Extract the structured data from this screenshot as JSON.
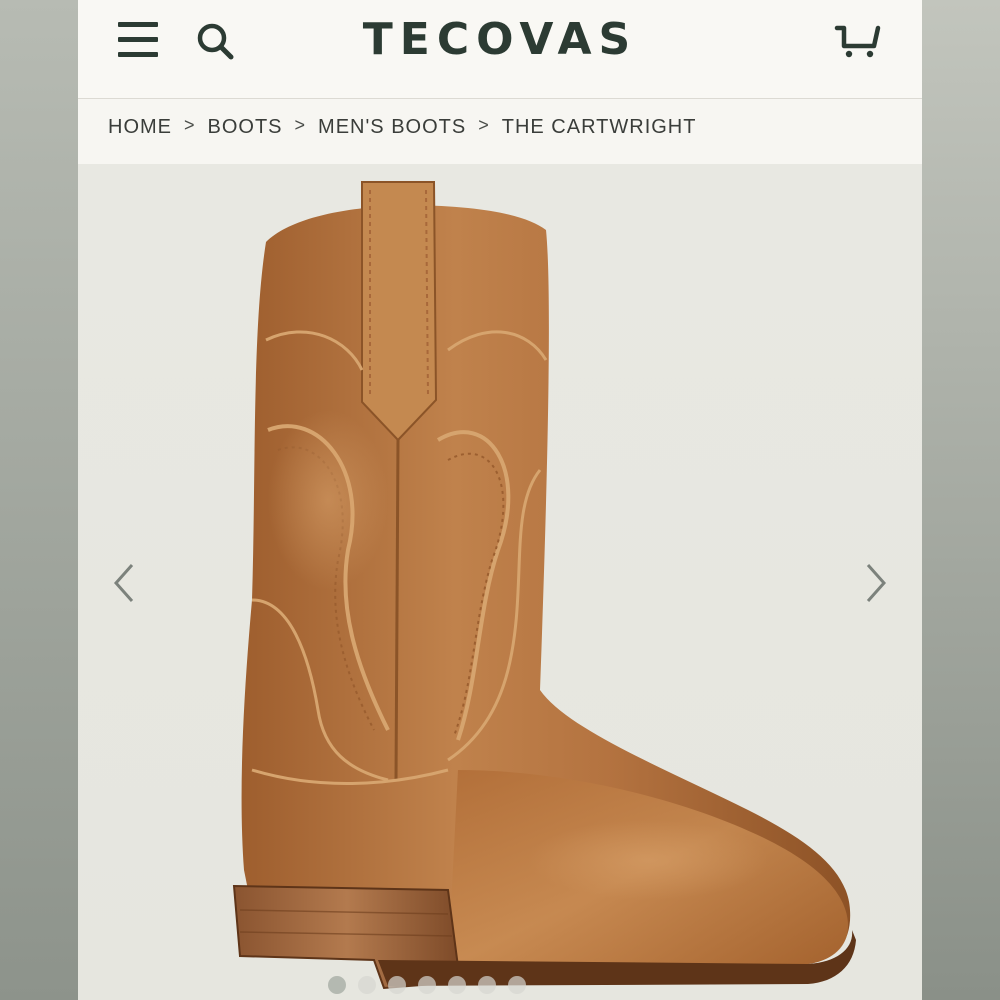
{
  "brand": {
    "logo_text": "TECOVAS",
    "color": "#2c3b33"
  },
  "header": {
    "icons": [
      "menu-icon",
      "search-icon",
      "cart-icon"
    ]
  },
  "breadcrumb": {
    "items": [
      "HOME",
      "BOOTS",
      "MEN'S BOOTS",
      "THE CARTWRIGHT"
    ],
    "separator": ">"
  },
  "gallery": {
    "image_alt": "brown leather western boot",
    "slide_count": 7,
    "active_index": 0,
    "prev_icon": "chevron-left-icon",
    "next_icon": "chevron-right-icon"
  },
  "colors": {
    "leather": "#b8743f",
    "leather_dark": "#7a4620",
    "background": "#e8e8e2",
    "header_bg": "#f9f8f4"
  }
}
